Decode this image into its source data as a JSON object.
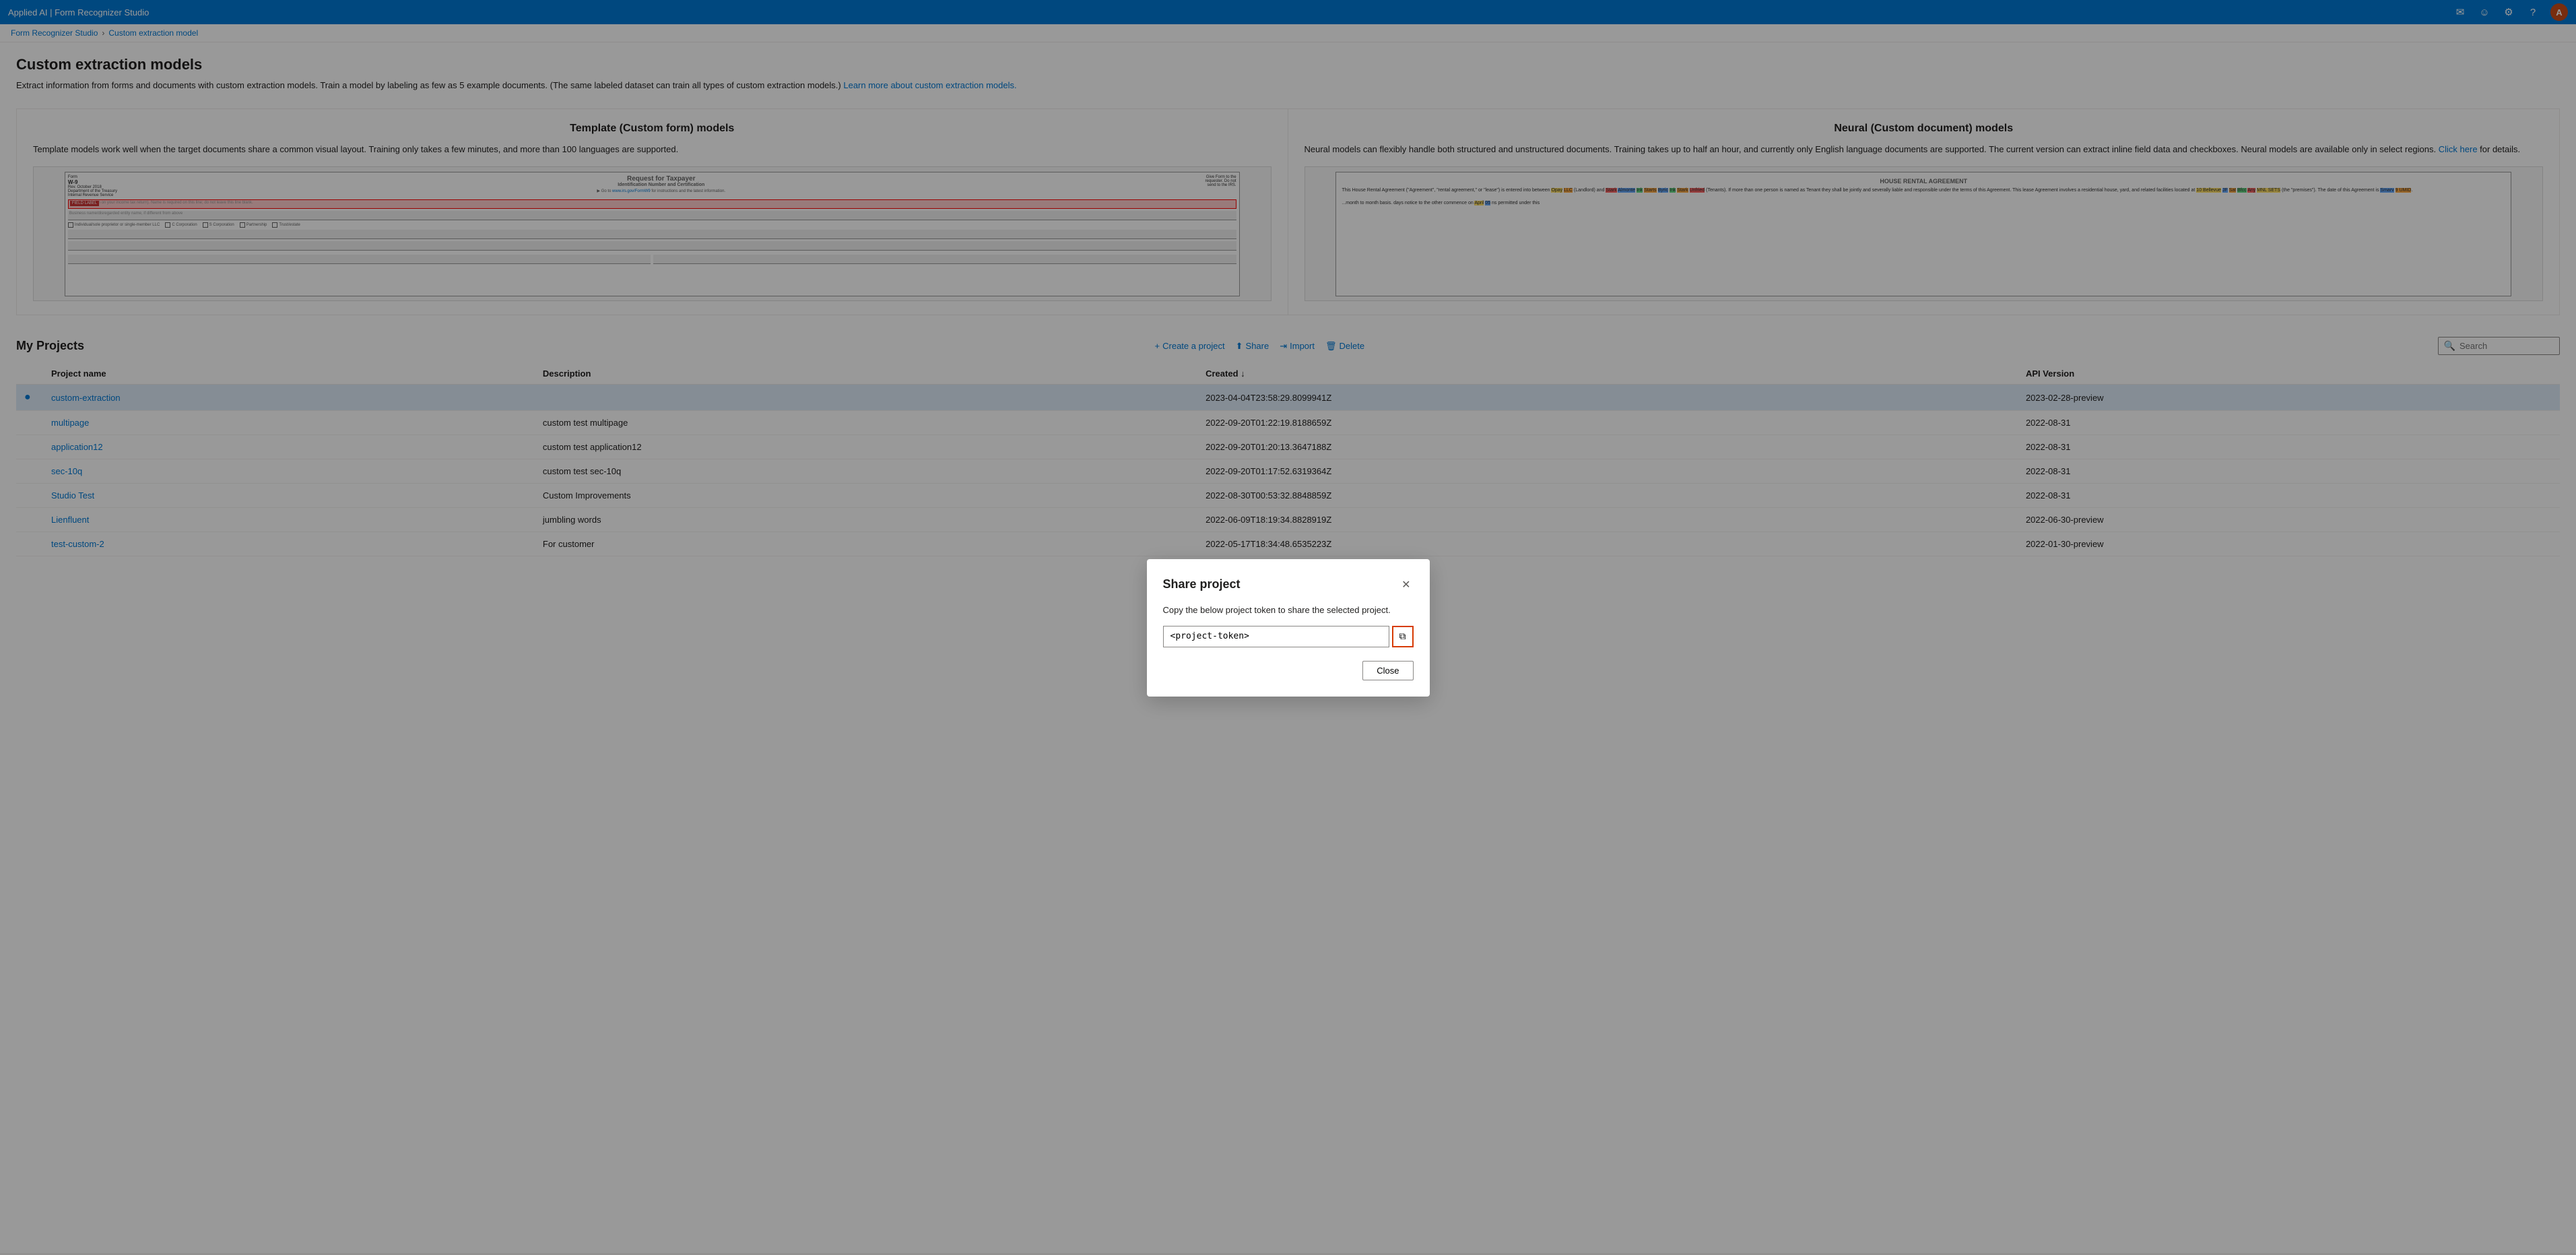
{
  "topNav": {
    "appName": "Applied AI | Form Recognizer Studio",
    "icons": [
      "email",
      "smiley",
      "settings",
      "help",
      "user"
    ]
  },
  "breadcrumb": {
    "items": [
      "Form Recognizer Studio",
      "Custom extraction model"
    ]
  },
  "page": {
    "title": "Custom extraction models",
    "description": "Extract information from forms and documents with custom extraction models. Train a model by labeling as few as 5 example documents. (The same labeled dataset can train all types of custom extraction models.)",
    "learnMoreText": "Learn more about custom extraction models.",
    "learnMoreUrl": "#"
  },
  "modelColumns": [
    {
      "title": "Template (Custom form) models",
      "description": "Template models work well when the target documents share a common visual layout. Training only takes a few minutes, and more than 100 languages are supported."
    },
    {
      "title": "Neural (Custom document) models",
      "description": "Neural models can flexibly handle both structured and unstructured documents. Training takes up to half an hour, and currently only English language documents are supported. The current version can extract inline field data and checkboxes. Neural models are available only in select regions.",
      "clickHereText": "Click here",
      "clickHereUrl": "#",
      "detailsText": "for details."
    }
  ],
  "projects": {
    "title": "My Projects",
    "actions": [
      {
        "icon": "+",
        "label": "Create a project"
      },
      {
        "icon": "↑",
        "label": "Share"
      },
      {
        "icon": "→",
        "label": "Import"
      },
      {
        "icon": "🗑",
        "label": "Delete"
      }
    ],
    "searchPlaceholder": "Search",
    "columns": [
      "Project name",
      "Description",
      "Created ↓",
      "API Version"
    ],
    "rows": [
      {
        "name": "custom-extraction",
        "description": "",
        "created": "2023-04-04T23:58:29.8099941Z",
        "apiVersion": "2023-02-28-preview",
        "selected": true
      },
      {
        "name": "multipage",
        "description": "custom test multipage",
        "created": "2022-09-20T01:22:19.8188659Z",
        "apiVersion": "2022-08-31",
        "selected": false
      },
      {
        "name": "application12",
        "description": "custom test application12",
        "created": "2022-09-20T01:20:13.3647188Z",
        "apiVersion": "2022-08-31",
        "selected": false
      },
      {
        "name": "sec-10q",
        "description": "custom test sec-10q",
        "created": "2022-09-20T01:17:52.6319364Z",
        "apiVersion": "2022-08-31",
        "selected": false
      },
      {
        "name": "Studio Test",
        "description": "Custom Improvements",
        "created": "2022-08-30T00:53:32.8848859Z",
        "apiVersion": "2022-08-31",
        "selected": false
      },
      {
        "name": "Lienfluent",
        "description": "jumbling words",
        "created": "2022-06-09T18:19:34.8828919Z",
        "apiVersion": "2022-06-30-preview",
        "selected": false
      },
      {
        "name": "test-custom-2",
        "description": "For customer",
        "created": "2022-05-17T18:34:48.6535223Z",
        "apiVersion": "2022-01-30-preview",
        "selected": false
      }
    ]
  },
  "modal": {
    "title": "Share project",
    "description": "Copy the below project token to share the selected project.",
    "tokenValue": "<project-token>",
    "tokenPlaceholder": "<project-token>",
    "closeLabel": "Close",
    "copyTitle": "Copy"
  }
}
